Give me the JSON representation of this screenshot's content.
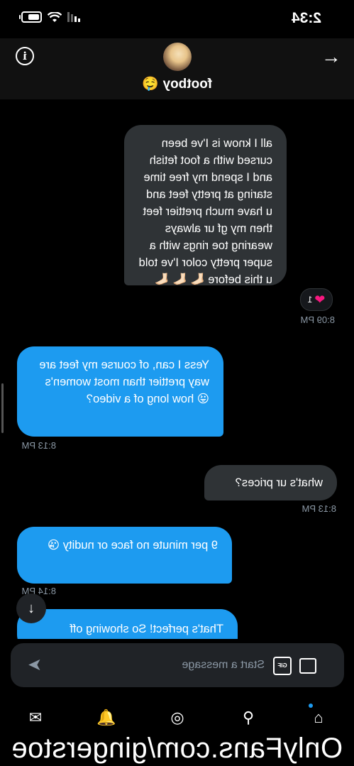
{
  "status_bar": {
    "time": "2:34",
    "battery_level": 0.7,
    "icons": [
      "signal-icon",
      "wifi-icon",
      "battery-icon"
    ]
  },
  "header": {
    "username": "footboy",
    "name_emoji": "🤤",
    "icons": [
      "back-arrow-icon",
      "avatar",
      "info-icon"
    ]
  },
  "messages": [
    {
      "id": "m1",
      "direction": "outgoing",
      "text": "all I know is I've been cursed with a foot fetish and I spend my free time staring at pretty feet and u have much prettier feet then my gf ur always wearing toe rings with a super pretty color I've told u this before 🦶🏻 🦶🏻 🦶🏻",
      "reaction": {
        "emoji": "❤️",
        "count": "1"
      },
      "time": "8:09 PM"
    },
    {
      "id": "m2",
      "direction": "incoming",
      "text": "Yess I can, of course my feet are way prettier than most women's 😜 how long of a video?",
      "time": "8:13 PM"
    },
    {
      "id": "m3",
      "direction": "outgoing",
      "text": "what's ur prices?",
      "time": "8:13 PM"
    },
    {
      "id": "m4",
      "direction": "incoming",
      "text": "9 per minute no face or nudity 😘",
      "time": "8:14 PM"
    },
    {
      "id": "m5",
      "direction": "incoming",
      "text": "That's perfect! So showing off"
    }
  ],
  "jump_to_bottom_icon": "arrow-down-icon",
  "composer": {
    "placeholder": "Start a message",
    "icons": [
      "image-icon",
      "gif-icon",
      "send-icon"
    ]
  },
  "bottom_nav": {
    "items": [
      "home-icon",
      "search-icon",
      "spaces-icon",
      "notifications-icon",
      "messages-icon"
    ],
    "active": "home-icon"
  },
  "watermark": "OnlyFans.com/gingerstoe"
}
